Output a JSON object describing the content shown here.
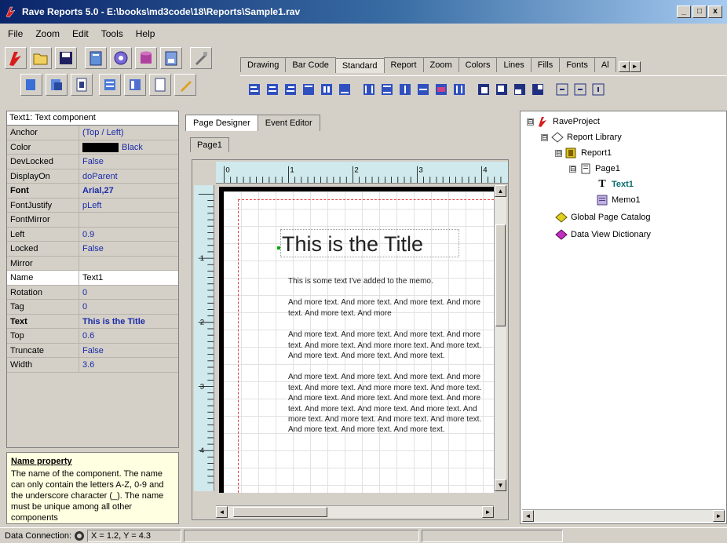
{
  "window": {
    "title": "Rave Reports 5.0 - E:\\books\\md3code\\18\\Reports\\Sample1.rav",
    "minimize": "_",
    "maximize": "□",
    "close": "x"
  },
  "menu": {
    "items": [
      "File",
      "Zoom",
      "Edit",
      "Tools",
      "Help"
    ]
  },
  "toolbar_tabs": {
    "tabs": [
      "Drawing",
      "Bar Code",
      "Standard",
      "Report",
      "Zoom",
      "Colors",
      "Lines",
      "Fills",
      "Fonts",
      "Al"
    ],
    "active": "Standard",
    "scroll_left": "◄",
    "scroll_right": "►"
  },
  "properties": {
    "header": "Text1: Text component",
    "rows": [
      {
        "name": "Anchor",
        "value": "(Top / Left)"
      },
      {
        "name": "Color",
        "value": "Black"
      },
      {
        "name": "DevLocked",
        "value": "False"
      },
      {
        "name": "DisplayOn",
        "value": "doParent"
      },
      {
        "name": "Font",
        "value": "Arial,27"
      },
      {
        "name": "FontJustify",
        "value": "pLeft"
      },
      {
        "name": "FontMirror",
        "value": ""
      },
      {
        "name": "Left",
        "value": "0.9"
      },
      {
        "name": "Locked",
        "value": "False"
      },
      {
        "name": "Mirror",
        "value": ""
      },
      {
        "name": "Name",
        "value": "Text1"
      },
      {
        "name": "Rotation",
        "value": "0"
      },
      {
        "name": "Tag",
        "value": "0"
      },
      {
        "name": "Text",
        "value": "This is the Title"
      },
      {
        "name": "Top",
        "value": "0.6"
      },
      {
        "name": "Truncate",
        "value": "False"
      },
      {
        "name": "Width",
        "value": "3.6"
      }
    ],
    "color_swatch": "#000000"
  },
  "help": {
    "title": "Name property",
    "body": "The name of the component. The name can only contain the letters A-Z, 0-9 and the underscore character (_). The name must be unique among all other components"
  },
  "designer": {
    "tabs": [
      "Page Designer",
      "Event Editor"
    ],
    "page_tab": "Page1",
    "ruler_h": [
      "0",
      "1",
      "2",
      "3",
      "4"
    ],
    "ruler_v": [
      "1",
      "2",
      "3",
      "4"
    ],
    "title_text": "This is the Title",
    "memo": [
      "This is some text I've added to the memo.",
      "And more text. And more text. And more text. And more text. And more text. And more",
      "And more text. And more text. And more text. And more text. And more text. And more more text. And more text. And more text. And more text. And more text.",
      "And more text. And more text. And more text. And more text. And more text. And more more text. And more text. And more text. And more text. And more text. And more text. And more text. And more text. And more text. And more text. And more text. And more text. And more text. And more text. And more text. And more text."
    ]
  },
  "tree": {
    "nodes": [
      {
        "label": "RaveProject",
        "expander": "⊟",
        "icon": "rave-project-icon"
      },
      {
        "label": "Report Library",
        "expander": "⊟",
        "icon": "report-library-icon"
      },
      {
        "label": "Report1",
        "expander": "⊟",
        "icon": "report-icon"
      },
      {
        "label": "Page1",
        "expander": "⊟",
        "icon": "page-icon"
      },
      {
        "label": "Text1",
        "expander": "",
        "icon": "text-component-icon",
        "selected": true
      },
      {
        "label": "Memo1",
        "expander": "",
        "icon": "memo-component-icon"
      },
      {
        "label": "Global Page Catalog",
        "expander": "",
        "icon": "global-page-catalog-icon"
      },
      {
        "label": "Data View Dictionary",
        "expander": "",
        "icon": "data-view-dictionary-icon"
      }
    ]
  },
  "status": {
    "connection_label": "Data Connection:",
    "coords": "X = 1.2, Y = 4.3"
  },
  "colors": {
    "title_gradient_start": "#0a246a",
    "ruler": "#cfe9ec",
    "property_value": "#1a2aa8",
    "selected_tree": "#0a6e6e"
  }
}
